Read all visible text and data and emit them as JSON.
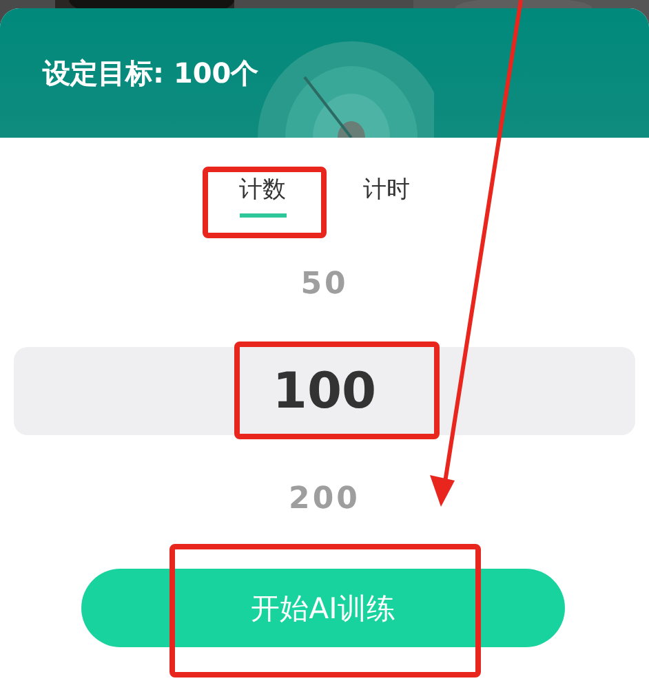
{
  "header": {
    "title": "设定目标: 100个"
  },
  "tabs": [
    {
      "label": "计数",
      "selected": true
    },
    {
      "label": "计时",
      "selected": false
    }
  ],
  "picker": {
    "options": [
      {
        "value": "50",
        "selected": false
      },
      {
        "value": "100",
        "selected": true
      },
      {
        "value": "200",
        "selected": false
      }
    ]
  },
  "start_button": {
    "label": "开始AI训练"
  }
}
